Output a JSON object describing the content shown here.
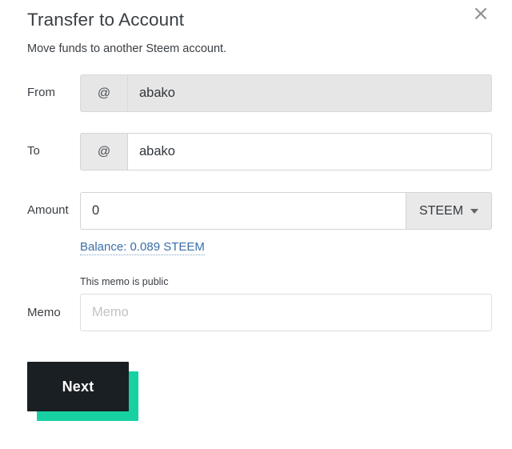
{
  "dialog": {
    "title": "Transfer to Account",
    "subtitle": "Move funds to another Steem account.",
    "close_label": "×"
  },
  "form": {
    "from": {
      "label": "From",
      "prefix": "@",
      "value": "abako",
      "placeholder": "",
      "disabled": true
    },
    "to": {
      "label": "To",
      "prefix": "@",
      "value": "abako",
      "placeholder": ""
    },
    "amount": {
      "label": "Amount",
      "value": "0",
      "placeholder": "",
      "asset": "STEEM",
      "balance_link": "Balance: 0.089 STEEM"
    },
    "memo": {
      "label": "Memo",
      "note": "This memo is public",
      "value": "",
      "placeholder": "Memo"
    }
  },
  "footer": {
    "next_label": "Next"
  },
  "colors": {
    "accent_teal": "#18d1a2",
    "button_dark": "#1a1f24",
    "link_blue": "#3b6ea8",
    "field_grey": "#e6e6e6",
    "border_grey": "#d4d4d4"
  }
}
